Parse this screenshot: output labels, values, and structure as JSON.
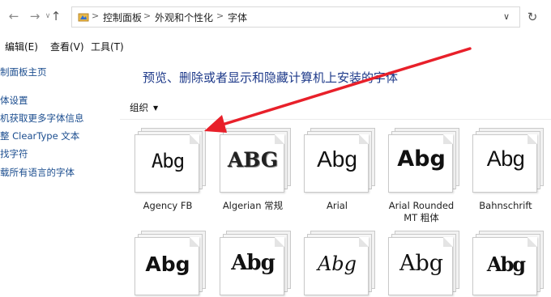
{
  "address_bar": {
    "crumbs": [
      "控制面板",
      "外观和个性化",
      "字体"
    ],
    "separator": ">"
  },
  "nav": {
    "back_icon": "←",
    "forward_icon": "→",
    "up_icon": "↑",
    "refresh_icon": "↻",
    "dropdown_icon": "∨"
  },
  "menu": {
    "items": [
      "编辑(E)",
      "查看(V)",
      "工具(T)"
    ]
  },
  "sidebar": {
    "links": [
      "制面板主页",
      "体设置",
      "机获取更多字体信息",
      "整 ClearType 文本",
      "找字符",
      "载所有语言的字体"
    ]
  },
  "main": {
    "title": "预览、删除或者显示和隐藏计算机上安装的字体",
    "organize_label": "组织"
  },
  "fonts": [
    {
      "sample": "Abg",
      "name": "Agency FB"
    },
    {
      "sample": "ABG",
      "name": "Algerian 常规"
    },
    {
      "sample": "Abg",
      "name": "Arial"
    },
    {
      "sample": "Abg",
      "name": "Arial Rounded",
      "name2": "MT 粗体"
    },
    {
      "sample": "Abg",
      "name": "Bahnschrift"
    },
    {
      "sample": "Abg",
      "name": ""
    },
    {
      "sample": "Abg",
      "name": ""
    },
    {
      "sample": "Abg",
      "name": ""
    },
    {
      "sample": "Abg",
      "name": ""
    },
    {
      "sample": "Abg",
      "name": ""
    }
  ],
  "colors": {
    "annotation_arrow": "#e8202a",
    "title": "#1e3a8a",
    "link": "#1b4d8f"
  }
}
